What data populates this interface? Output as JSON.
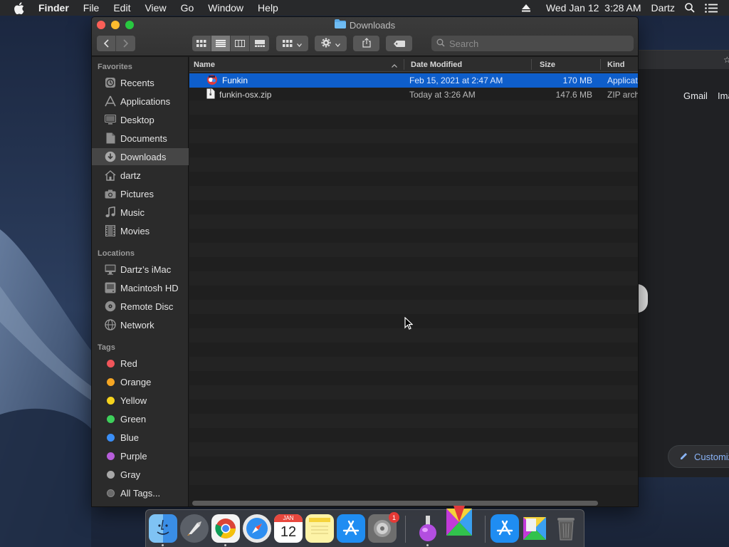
{
  "menubar": {
    "app_name": "Finder",
    "items": [
      "File",
      "Edit",
      "View",
      "Go",
      "Window",
      "Help"
    ],
    "clock": "Wed Jan 12  3:28 AM",
    "user": "Dartz"
  },
  "window": {
    "title": "Downloads",
    "search_placeholder": "Search"
  },
  "sidebar": {
    "favorites_heading": "Favorites",
    "favorites": [
      {
        "label": "Recents",
        "icon": "clock-icon"
      },
      {
        "label": "Applications",
        "icon": "applications-icon"
      },
      {
        "label": "Desktop",
        "icon": "desktop-icon"
      },
      {
        "label": "Documents",
        "icon": "document-icon"
      },
      {
        "label": "Downloads",
        "icon": "download-icon"
      },
      {
        "label": "dartz",
        "icon": "home-icon"
      },
      {
        "label": "Pictures",
        "icon": "camera-icon"
      },
      {
        "label": "Music",
        "icon": "music-note-icon"
      },
      {
        "label": "Movies",
        "icon": "film-icon"
      }
    ],
    "locations_heading": "Locations",
    "locations": [
      {
        "label": "Dartz’s iMac",
        "icon": "imac-icon"
      },
      {
        "label": "Macintosh HD",
        "icon": "hard-disk-icon"
      },
      {
        "label": "Remote Disc",
        "icon": "disc-icon"
      },
      {
        "label": "Network",
        "icon": "globe-icon"
      }
    ],
    "tags_heading": "Tags",
    "tags": [
      {
        "label": "Red",
        "color": "#f0555a"
      },
      {
        "label": "Orange",
        "color": "#f5a623"
      },
      {
        "label": "Yellow",
        "color": "#f6d31d"
      },
      {
        "label": "Green",
        "color": "#3ed05b"
      },
      {
        "label": "Blue",
        "color": "#3a8ef6"
      },
      {
        "label": "Purple",
        "color": "#b75edb"
      },
      {
        "label": "Gray",
        "color": "#a8a8a8"
      },
      {
        "label": "All Tags...",
        "color": "#6a6a6a"
      }
    ]
  },
  "columns": {
    "name": "Name",
    "date_modified": "Date Modified",
    "size": "Size",
    "kind": "Kind"
  },
  "files": [
    {
      "name": "Funkin",
      "date": "Feb 15, 2021 at 2:47 AM",
      "size": "170 MB",
      "kind": "Application",
      "icon": "funkin-app-icon",
      "selected": true
    },
    {
      "name": "funkin-osx.zip",
      "date": "Today at 3:26 AM",
      "size": "147.6 MB",
      "kind": "ZIP archive",
      "icon": "zip-file-icon",
      "selected": false
    }
  ],
  "background_window": {
    "gmail": "Gmail",
    "images": "Images",
    "customize": "Customize"
  },
  "dock": {
    "calendar_month": "JAN",
    "calendar_day": "12",
    "app_store_badge": "1"
  }
}
